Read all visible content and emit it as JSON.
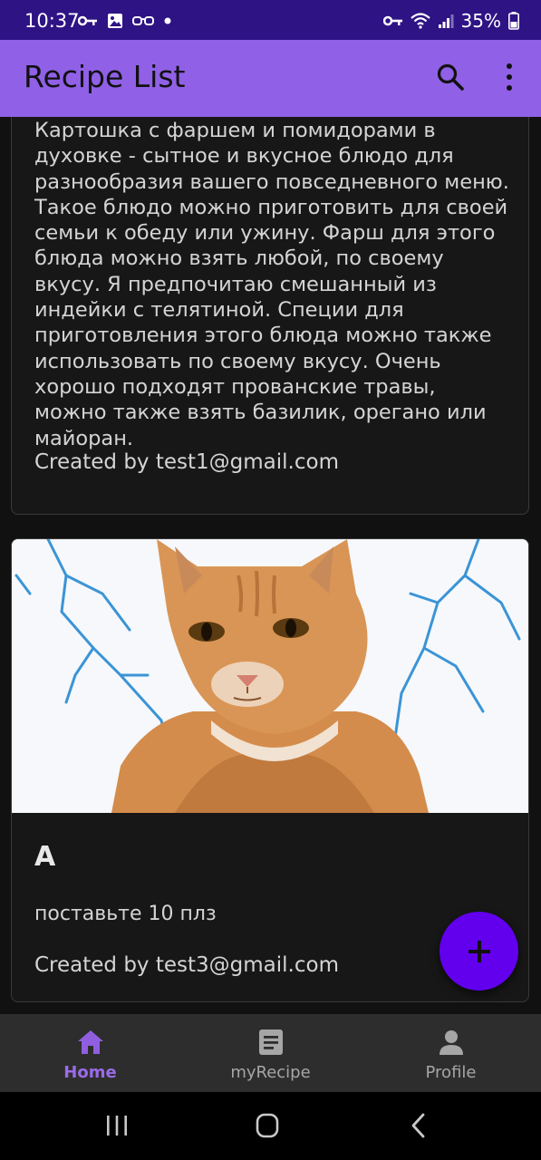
{
  "status_bar": {
    "time": "10:37",
    "battery_percent": "35%",
    "left_icons": [
      "key-icon",
      "image-icon",
      "glasses-icon",
      "dot-icon"
    ],
    "right_icons": [
      "key-icon",
      "wifi-icon",
      "signal-icon",
      "battery-icon"
    ]
  },
  "app_bar": {
    "title": "Recipe List",
    "icons": [
      "search-icon",
      "more-vert-icon"
    ]
  },
  "recipes": [
    {
      "title": "",
      "description": "Картошка с фаршем и помидорами в духовке - сытное и вкусное блюдо для разнообразия вашего повседневного меню. Такое блюдо можно приготовить для своей семьи к обеду или ужину. Фарш для этого блюда можно взять любой, по своему вкусу. Я предпочитаю смешанный из индейки с телятиной. Специи для приготовления этого блюда можно также использовать по своему вкусу. Очень хорошо подходят прованские травы, можно также взять базилик, орегано или майоран.",
      "author": "Created by test1@gmail.com"
    },
    {
      "title": "A",
      "description": "поставьте 10 плз",
      "author": "Created by test3@gmail.com",
      "image": "orange-cat-photo"
    }
  ],
  "fab": {
    "icon": "plus-icon"
  },
  "bottom_nav": {
    "items": [
      {
        "label": "Home",
        "icon": "home-icon",
        "active": true
      },
      {
        "label": "myRecipe",
        "icon": "article-icon",
        "active": false
      },
      {
        "label": "Profile",
        "icon": "person-icon",
        "active": false
      }
    ]
  },
  "colors": {
    "status_bar": "#2e1385",
    "app_bar": "#9060e6",
    "fab": "#6200ee",
    "nav_active": "#9a6be8",
    "background": "#111111"
  }
}
